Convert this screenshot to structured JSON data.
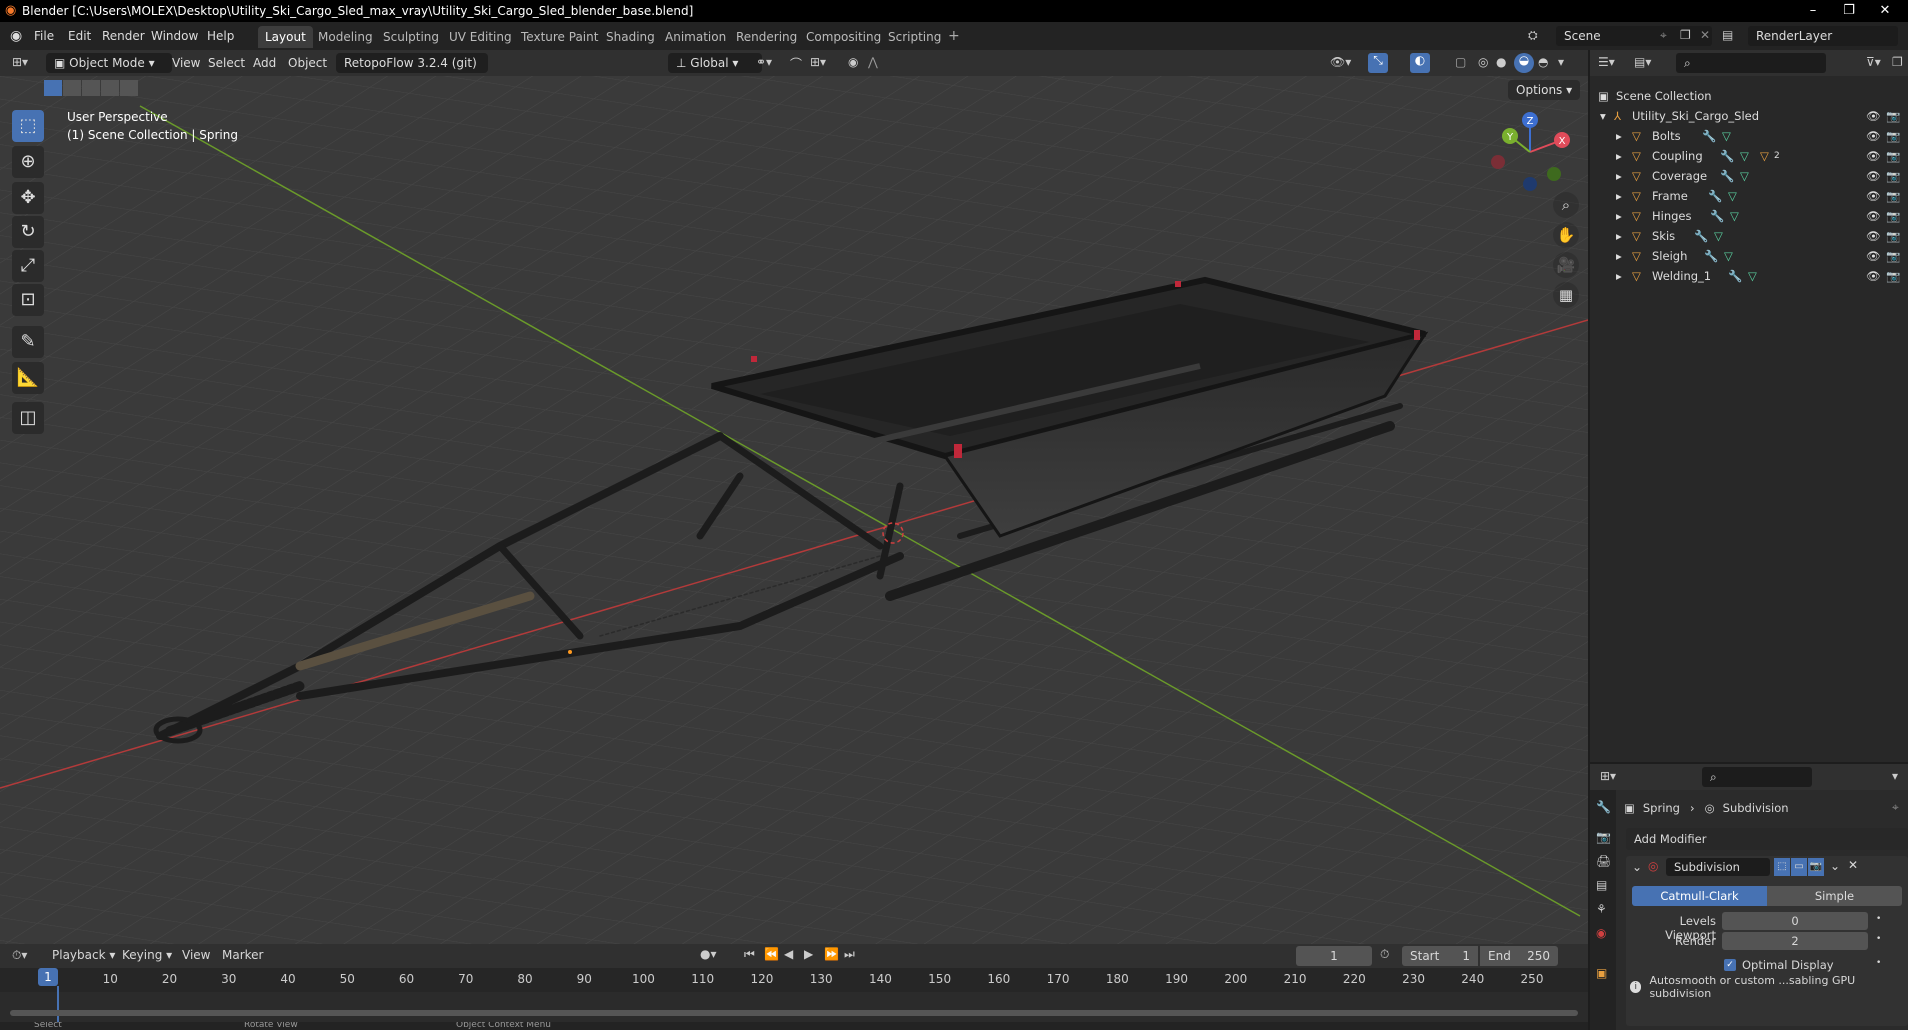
{
  "window": {
    "title": "Blender [C:\\Users\\MOLEX\\Desktop\\Utility_Ski_Cargo_Sled_max_vray\\Utility_Ski_Cargo_Sled_blender_base.blend]"
  },
  "menu": [
    "File",
    "Edit",
    "Render",
    "Window",
    "Help"
  ],
  "workspaces": [
    "Layout",
    "Modeling",
    "Sculpting",
    "UV Editing",
    "Texture Paint",
    "Shading",
    "Animation",
    "Rendering",
    "Compositing",
    "Scripting"
  ],
  "scene": {
    "label": "Scene",
    "render_layer": "RenderLayer"
  },
  "viewport_header": {
    "mode": "Object Mode",
    "view": "View",
    "select": "Select",
    "add": "Add",
    "object": "Object",
    "addon": "RetopoFlow 3.2.4 (git)",
    "orientation": "Global",
    "options": "Options"
  },
  "viewport": {
    "perspective": "User Perspective",
    "context": "(1) Scene Collection | Spring"
  },
  "gizmo": {
    "x": "X",
    "y": "Y",
    "z": "Z"
  },
  "outliner": {
    "root": "Scene Collection",
    "collection": "Utility_Ski_Cargo_Sled",
    "objects": [
      "Bolts",
      "Coupling",
      "Coverage",
      "Frame",
      "Hinges",
      "Skis",
      "Sleigh",
      "Welding_1"
    ],
    "coupling_badge": "2"
  },
  "properties": {
    "breadcrumb_object": "Spring",
    "breadcrumb_modifier": "Subdivision",
    "add_modifier": "Add Modifier",
    "modifier_name": "Subdivision",
    "type_options": [
      "Catmull-Clark",
      "Simple"
    ],
    "levels_viewport_label": "Levels Viewport",
    "levels_viewport_value": "0",
    "render_label": "Render",
    "render_value": "2",
    "optimal_display": "Optimal Display",
    "warning": "Autosmooth or custom ...sabling GPU subdivision"
  },
  "timeline": {
    "playback": "Playback",
    "keying": "Keying",
    "view": "View",
    "marker": "Marker",
    "current_frame": "1",
    "start_label": "Start",
    "start": "1",
    "end_label": "End",
    "end": "250",
    "ticks": [
      "1",
      "10",
      "20",
      "30",
      "40",
      "50",
      "60",
      "70",
      "80",
      "90",
      "100",
      "110",
      "120",
      "130",
      "140",
      "150",
      "160",
      "170",
      "180",
      "190",
      "200",
      "210",
      "220",
      "230",
      "240",
      "250"
    ]
  },
  "status_bar": {
    "select": "Select",
    "rotate": "Rotate View",
    "context": "Object Context Menu"
  },
  "colors": {
    "accent": "#4772b3",
    "grid_x": "#b33a3a",
    "grid_y": "#6a9a2a",
    "viewport_bg": "#3a3a3a"
  }
}
